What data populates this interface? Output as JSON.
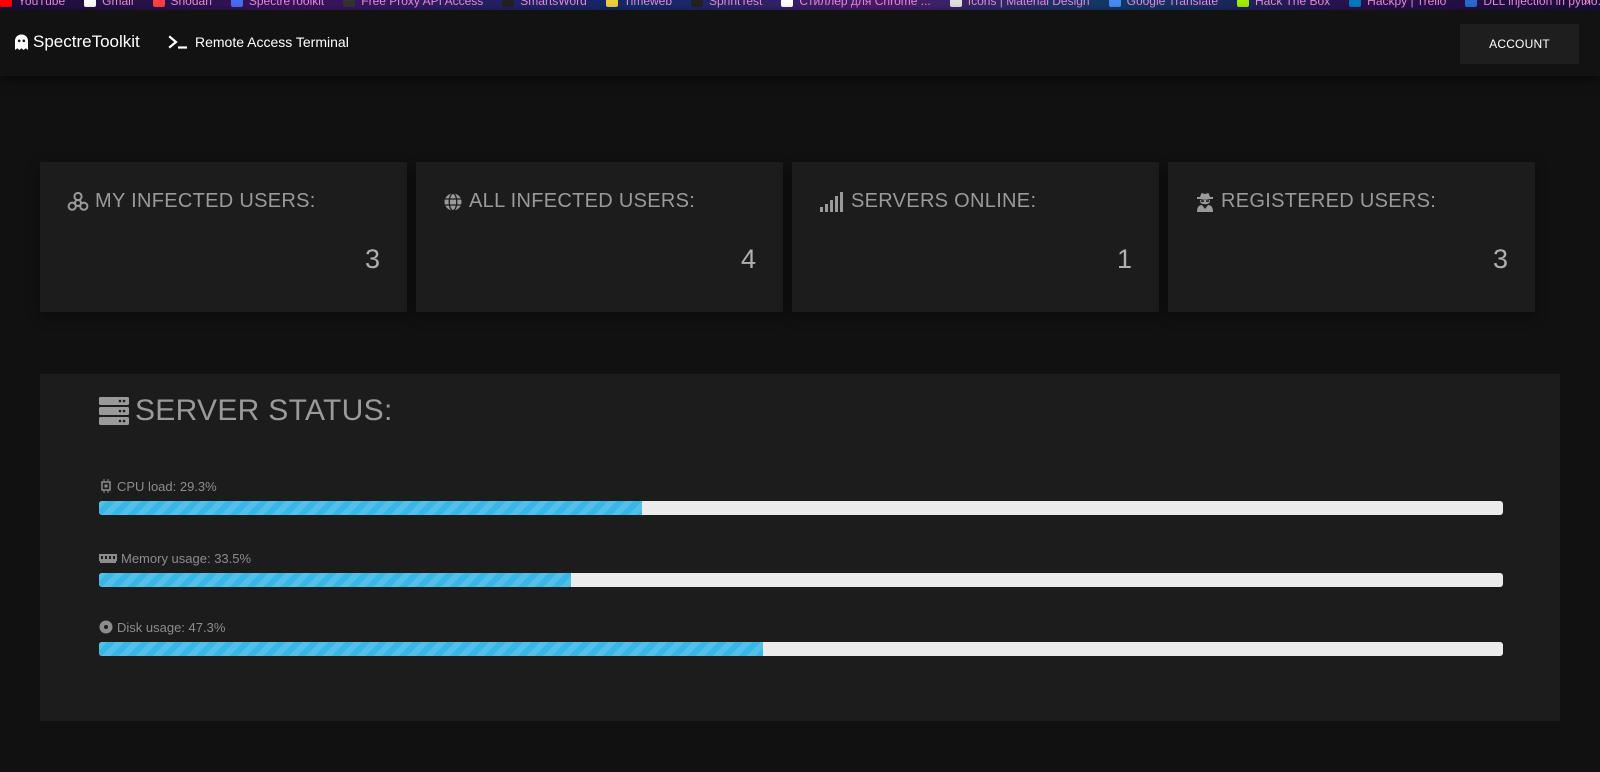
{
  "bookmarks": [
    {
      "label": "YouTube",
      "color": "#ff0000"
    },
    {
      "label": "Gmail",
      "color": "#ffffff"
    },
    {
      "label": "Shodan",
      "color": "#ff4040"
    },
    {
      "label": "SpectreToolkit",
      "color": "#4a6cf0"
    },
    {
      "label": "Free Proxy API Access",
      "color": "#333333"
    },
    {
      "label": "SmartsWord",
      "color": "#222222"
    },
    {
      "label": "Timeweb",
      "color": "#f0d040"
    },
    {
      "label": "SprintTest",
      "color": "#222222"
    },
    {
      "label": "Стиллер для Chrome ...",
      "color": "#ffffff"
    },
    {
      "label": "Icons | Material Design",
      "color": "#e0e0e0"
    },
    {
      "label": "Google Translate",
      "color": "#4a8af4"
    },
    {
      "label": "Hack The Box",
      "color": "#9fef00"
    },
    {
      "label": "Hackpy | Trello",
      "color": "#0079bf"
    },
    {
      "label": "DLL injection in pytho...",
      "color": "#2a6ad0"
    }
  ],
  "bookmarks_more": "»",
  "navbar": {
    "brand": "SpectreToolkit",
    "terminal_link": "Remote Access Terminal",
    "account_button": "ACCOUNT"
  },
  "cards": [
    {
      "icon": "biohazard-icon",
      "title": "MY INFECTED USERS:",
      "value": "3"
    },
    {
      "icon": "globe-icon",
      "title": "ALL INFECTED USERS:",
      "value": "4"
    },
    {
      "icon": "signal-icon",
      "title": "SERVERS ONLINE:",
      "value": "1"
    },
    {
      "icon": "user-secret-icon",
      "title": "REGISTERED USERS:",
      "value": "3"
    }
  ],
  "server_status": {
    "title": "SERVER STATUS:",
    "metrics": [
      {
        "icon": "cpu-icon",
        "label": "CPU load: 29.3%",
        "fill_fraction": 0.387
      },
      {
        "icon": "memory-icon",
        "label": "Memory usage: 33.5%",
        "fill_fraction": 0.336
      },
      {
        "icon": "disk-icon",
        "label": "Disk usage: 47.3%",
        "fill_fraction": 0.473
      }
    ]
  },
  "colors": {
    "background": "#111111",
    "card": "#1c1c1c",
    "progress_fill": "#38b6e6",
    "progress_track": "#ebebeb"
  }
}
